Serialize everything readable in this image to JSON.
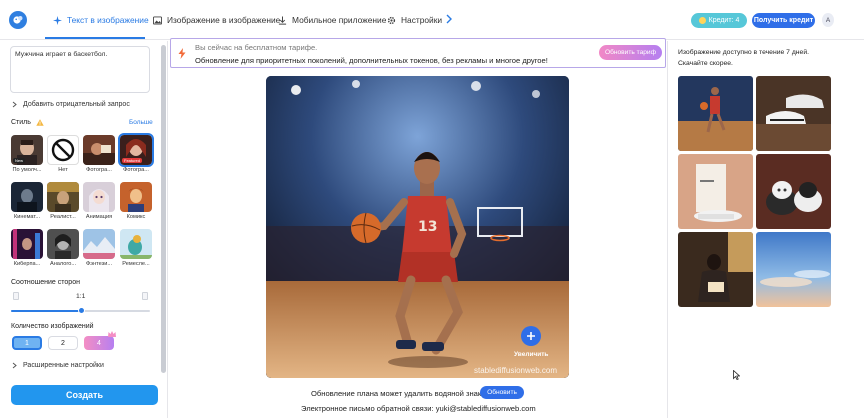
{
  "header": {
    "tabs": [
      {
        "label": "Текст в изображение",
        "active": true
      },
      {
        "label": "Изображение в изображение",
        "active": false
      },
      {
        "label": "Мобильное приложение",
        "active": false
      },
      {
        "label": "Настройки",
        "active": false
      }
    ],
    "credit_label": "Кредит: 4",
    "get_credit_label": "Получить кредит",
    "avatar_letter": "A"
  },
  "left": {
    "prompt": "Мужчина играет в баскетбол.",
    "negative_link": "Добавить отрицательный запрос",
    "style_label": "Стиль",
    "more_label": "Больше",
    "styles": [
      {
        "caption": "По умолч...",
        "badge": "New"
      },
      {
        "caption": "Нет",
        "badge": ""
      },
      {
        "caption": "Фотогра...",
        "badge": ""
      },
      {
        "caption": "Фотогра...",
        "badge": "Featured",
        "selected": true
      },
      {
        "caption": "Кинемат...",
        "badge": ""
      },
      {
        "caption": "Реалист...",
        "badge": ""
      },
      {
        "caption": "Анимация",
        "badge": ""
      },
      {
        "caption": "Комикс",
        "badge": ""
      },
      {
        "caption": "Киберпа...",
        "badge": ""
      },
      {
        "caption": "Аналого...",
        "badge": ""
      },
      {
        "caption": "Фэнтези...",
        "badge": ""
      },
      {
        "caption": "Ремесле...",
        "badge": ""
      }
    ],
    "ratio_label": "Соотношение сторон",
    "ratio_value": "1:1",
    "count_label": "Количество изображений",
    "counts": [
      "1",
      "2",
      "4"
    ],
    "advanced_label": "Расширенные настройки",
    "create_label": "Создать"
  },
  "banner": {
    "line1": "Вы сейчас на бесплатном тарифе.",
    "line2": "Обновление для приоритетных поколений, дополнительных токенов, без рекламы и многое другое!",
    "button": "Обновить тариф"
  },
  "main": {
    "zoom_label": "Увеличить",
    "watermark": "stablediffusionweb.com",
    "watermark_note": "Обновление плана может удалить водяной знак",
    "watermark_button": "Обновить",
    "feedback": "Электронное письмо обратной связи: yuki@stablediffusionweb.com"
  },
  "right": {
    "availability_1": "Изображение доступно в течение 7 дней.",
    "availability_2": "Скачайте скорее."
  },
  "colors": {
    "accent": "#2a7be4",
    "create": "#2296ee",
    "credit": "#56c7d8",
    "premium_gradient_start": "#f188c6",
    "premium_gradient_end": "#b57ff0"
  }
}
